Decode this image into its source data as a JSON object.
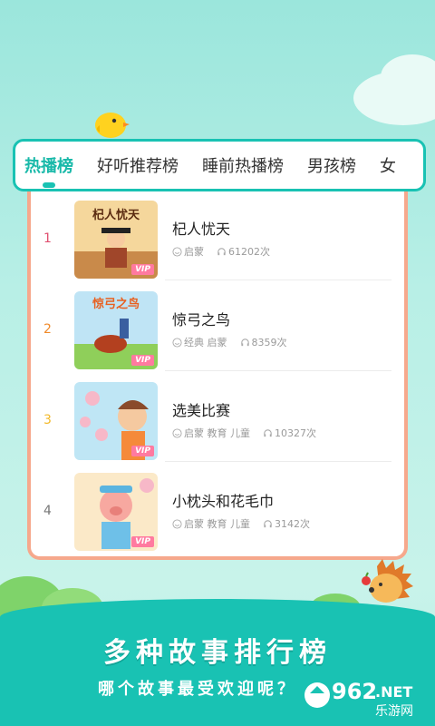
{
  "tabs": [
    {
      "label": "热播榜",
      "active": true
    },
    {
      "label": "好听推荐榜",
      "active": false
    },
    {
      "label": "睡前热播榜",
      "active": false
    },
    {
      "label": "男孩榜",
      "active": false
    },
    {
      "label": "女",
      "active": false
    }
  ],
  "stories": [
    {
      "rank": "1",
      "rank_color": "#e05070",
      "title": "杞人忧天",
      "thumb_caption": "杞人忧天",
      "tags": "启蒙",
      "plays": "61202次",
      "badge": "VIP"
    },
    {
      "rank": "2",
      "rank_color": "#f08a2a",
      "title": "惊弓之鸟",
      "thumb_caption": "惊弓之鸟",
      "tags": "经典 启蒙",
      "plays": "8359次",
      "badge": "VIP"
    },
    {
      "rank": "3",
      "rank_color": "#f2b92a",
      "title": "选美比赛",
      "tags": "启蒙 教育 儿童",
      "plays": "10327次",
      "badge": "VIP"
    },
    {
      "rank": "4",
      "rank_color": "#777777",
      "title": "小枕头和花毛巾",
      "tags": "启蒙 教育 儿童",
      "plays": "3142次",
      "badge": "VIP"
    }
  ],
  "promo": {
    "headline": "多种故事排行榜",
    "subline": "哪个故事最受欢迎呢？"
  },
  "watermark": {
    "number": "962",
    "suffix": ".NET",
    "site": "乐游网"
  },
  "colors": {
    "accent": "#19c2b3",
    "card_border": "#f6a88c",
    "vip": "#ff7aa0"
  }
}
